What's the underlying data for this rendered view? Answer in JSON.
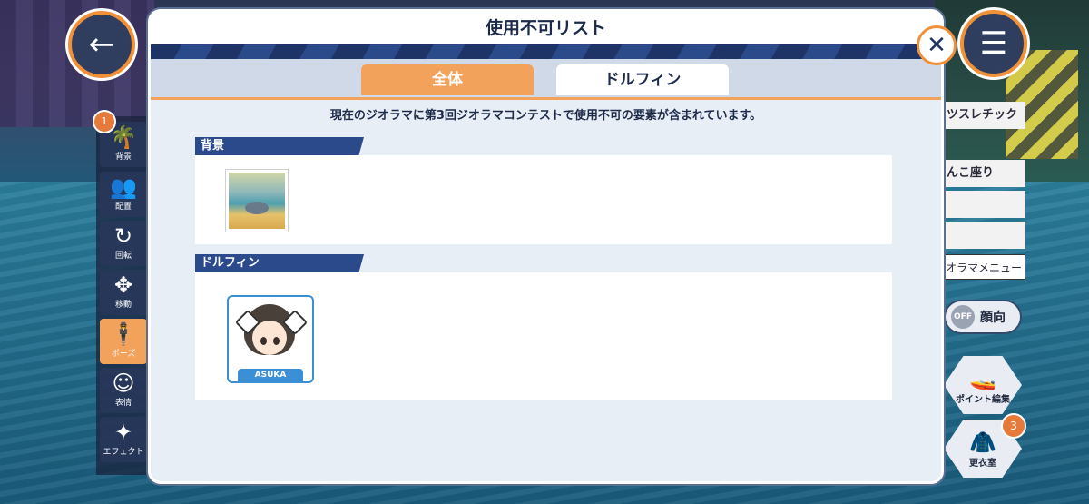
{
  "dialog": {
    "title": "使用不可リスト",
    "tabs": [
      {
        "label": "全体",
        "active": true
      },
      {
        "label": "ドルフィン",
        "active": false
      }
    ],
    "notice": "現在のジオラマに第3回ジオラマコンテストで使用不可の要素が含まれています。",
    "sections": [
      {
        "title": "背景",
        "items": [
          "background-thumbnail"
        ]
      },
      {
        "title": "ドルフィン",
        "items": [
          {
            "name": "ASUKA"
          }
        ]
      }
    ],
    "close_icon": "close-icon"
  },
  "tools": [
    {
      "label": "背景",
      "icon": "palm-icon",
      "badge": "1"
    },
    {
      "label": "配置",
      "icon": "people-icon"
    },
    {
      "label": "回転",
      "icon": "rotate-icon"
    },
    {
      "label": "移動",
      "icon": "move-icon"
    },
    {
      "label": "ポーズ",
      "icon": "pose-icon",
      "active": true
    },
    {
      "label": "表情",
      "icon": "face-icon"
    },
    {
      "label": "エフェクト",
      "icon": "sparkle-icon"
    }
  ],
  "right_panel": {
    "items": [
      "ツスレチック",
      "んこ座り",
      "",
      ""
    ],
    "menu_label": "オラマメニュー",
    "face_toggle": {
      "state": "OFF",
      "label": "顔向"
    },
    "point_edit": "ポイント編集",
    "wardrobe": {
      "label": "更衣室",
      "badge": "3"
    }
  },
  "colors": {
    "accent": "#f3a25c",
    "navy": "#2a4a8c",
    "outline": "#3b8fd4"
  }
}
